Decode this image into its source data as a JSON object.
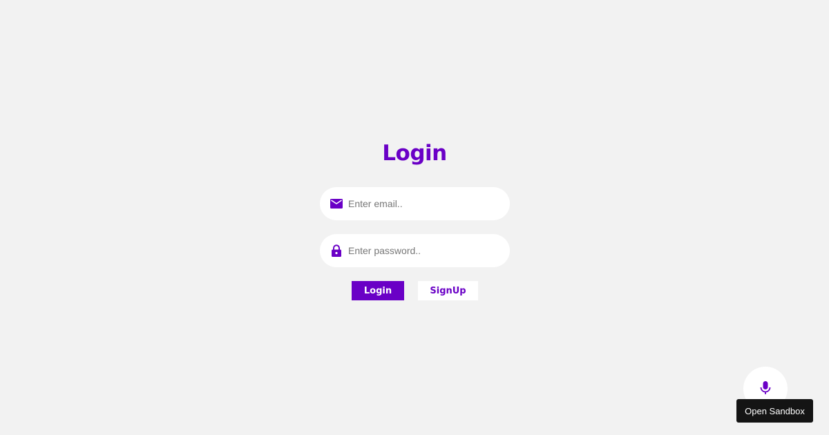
{
  "login_form": {
    "title": "Login",
    "email": {
      "icon": "mail-icon",
      "value": "",
      "placeholder": "Enter email.."
    },
    "password": {
      "icon": "lock-icon",
      "value": "",
      "placeholder": "Enter password.."
    },
    "login_label": "Login",
    "signup_label": "SignUp"
  },
  "floating": {
    "mic_icon": "microphone-icon",
    "tooltip": "Open Sandbox"
  },
  "colors": {
    "background": "#f2f2f2",
    "accent": "#6a00c6",
    "field_bg": "#ffffff",
    "tooltip_bg": "#141414"
  }
}
